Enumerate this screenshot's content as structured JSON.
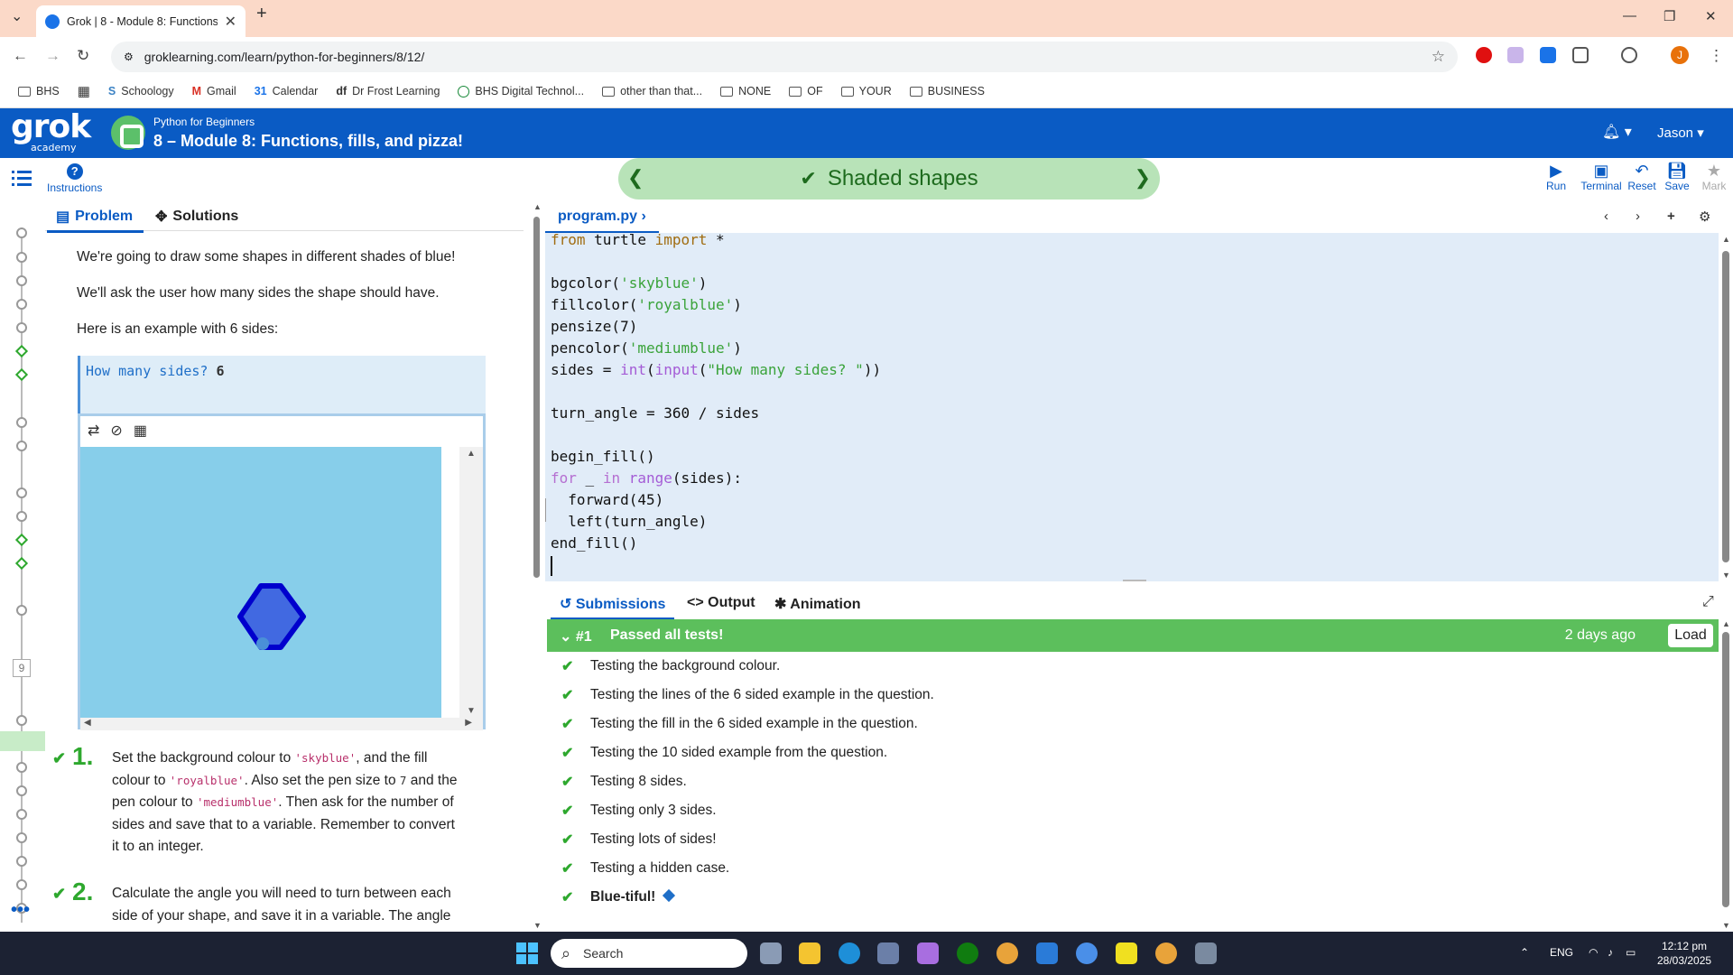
{
  "browser": {
    "tab_title": "Grok | 8 - Module 8: Functions,",
    "url": "groklearning.com/learn/python-for-beginners/8/12/",
    "bookmarks": [
      "BHS",
      "Schoology",
      "Gmail",
      "Calendar",
      "Dr Frost Learning",
      "BHS Digital Technol...",
      "other than that...",
      "NONE",
      "OF",
      "YOUR",
      "BUSINESS"
    ],
    "profile_initial": "J"
  },
  "header": {
    "logo": "grok",
    "logo_sub": "academy",
    "course": "Python for Beginners",
    "module": "8 – Module 8: Functions, fills, and pizza!",
    "user": "Jason"
  },
  "subbar": {
    "instructions": "Instructions",
    "problem_title": "Shaded shapes",
    "buttons": {
      "run": "Run",
      "terminal": "Terminal",
      "reset": "Reset",
      "save": "Save",
      "mark": "Mark"
    }
  },
  "rail": {
    "box_number": "9"
  },
  "problem": {
    "tabs": {
      "problem": "Problem",
      "solutions": "Solutions"
    },
    "intro": "We're going to draw some shapes in different shades of blue!",
    "ask": "We'll ask the user how many sides the shape should have.",
    "example_intro": "Here is an example with 6 sides:",
    "example_prompt": "How many sides?",
    "example_input": "6",
    "steps": [
      {
        "num": "1.",
        "parts": [
          "Set the background colour to ",
          "'skyblue'",
          ", and the fill colour to ",
          "'royalblue'",
          ". Also set the pen size to ",
          "7",
          " and the pen colour to ",
          "'mediumblue'",
          ". Then ask for the number of sides and save that to a variable. Remember to convert it to an integer."
        ]
      },
      {
        "num": "2.",
        "parts": [
          "Calculate the angle you will need to turn between each side of your shape, and save it in a variable. The angle"
        ]
      }
    ]
  },
  "editor": {
    "file": "program.py",
    "lines": [
      "from turtle import *",
      "",
      "bgcolor('skyblue')",
      "fillcolor('royalblue')",
      "pensize(7)",
      "pencolor('mediumblue')",
      "sides = int(input(\"How many sides? \"))",
      "",
      "turn_angle = 360 / sides",
      "",
      "begin_fill()",
      "for _ in range(sides):",
      "  forward(45)",
      "  left(turn_angle)",
      "end_fill()",
      ""
    ]
  },
  "submissions": {
    "tabs": {
      "submissions": "Submissions",
      "output": "Output",
      "animation": "Animation"
    },
    "id": "#1",
    "status": "Passed all tests!",
    "when": "2 days ago",
    "load": "Load",
    "tests": [
      "Testing the background colour.",
      "Testing the lines of the 6 sided example in the question.",
      "Testing the fill in the 6 sided example in the question.",
      "Testing the 10 sided example from the question.",
      "Testing 8 sides.",
      "Testing only 3 sides.",
      "Testing lots of sides!",
      "Testing a hidden case.",
      "Blue-tiful!"
    ]
  },
  "taskbar": {
    "search": "Search",
    "lang": "ENG",
    "time": "12:12 pm",
    "date": "28/03/2025"
  },
  "colors": {
    "grok_blue": "#0a5bc4",
    "pass_green": "#5cbf5c",
    "canvas_bg": "#87ceea",
    "shape_fill": "#4169e1",
    "shape_pen": "#0000cd"
  }
}
